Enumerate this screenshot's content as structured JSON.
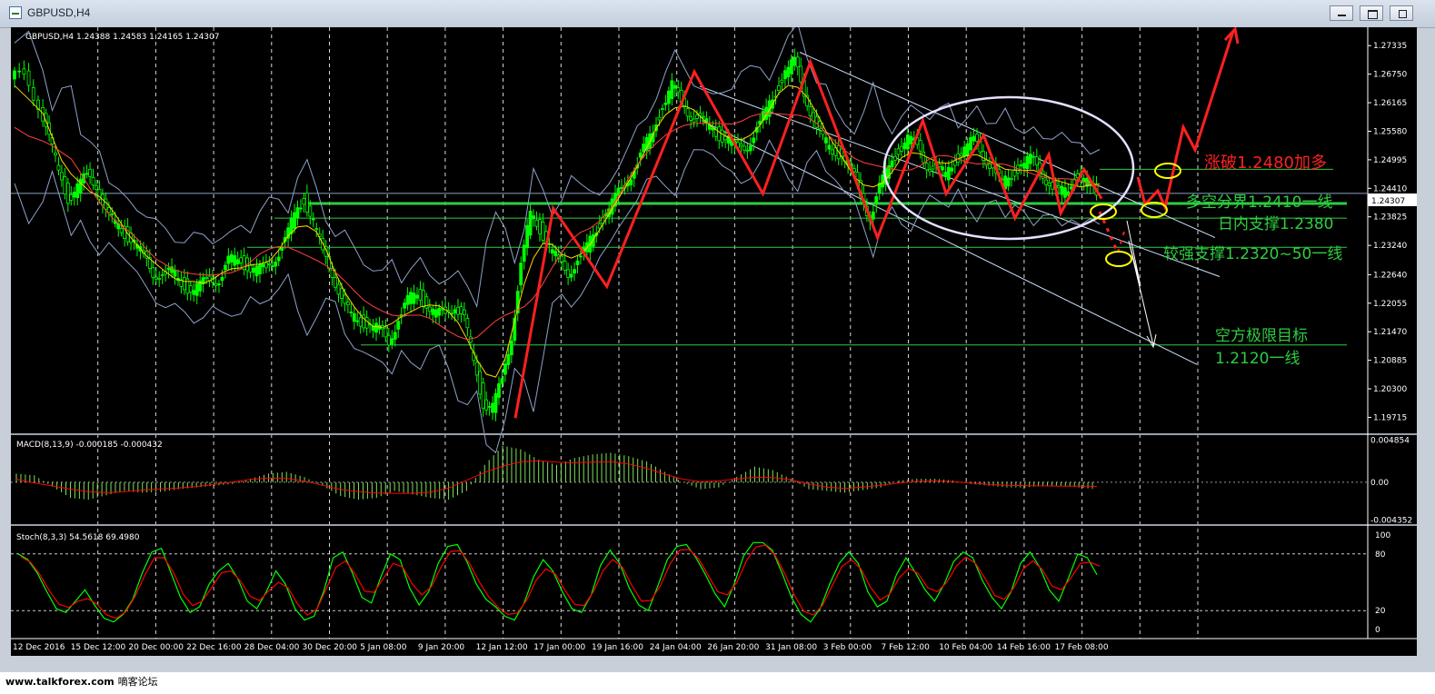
{
  "window": {
    "title": "GBPUSD,H4",
    "buttons": [
      "minimize",
      "restore",
      "close"
    ]
  },
  "footer": {
    "site": "www.talkforex.com",
    "forum": "嘀客论坛"
  },
  "colors": {
    "background": "#000000",
    "bull_candle": "#00ff00",
    "grid": "#ffffff",
    "annotation_red": "#ff2020",
    "annotation_green": "#2ecc40",
    "channel": "#cfe3ff",
    "highlight_ellipse": "#ffff00",
    "macd_signal": "#ff0000",
    "stoch_main": "#00ff00",
    "stoch_signal": "#ff0000"
  },
  "chart_data": [
    {
      "type": "candlestick",
      "symbol_header": "GBPUSD,H4  1.24388 1.24583 1.24165 1.24307",
      "price_axis_ticks": [
        "1.27335",
        "1.26750",
        "1.26165",
        "1.25580",
        "1.24995",
        "1.24410",
        "1.23825",
        "1.23240",
        "1.22640",
        "1.22055",
        "1.21470",
        "1.20885",
        "1.20300",
        "1.19715"
      ],
      "current_price_label": "1.24307",
      "time_axis_labels": [
        "12 Dec 2016",
        "15 Dec 12:00",
        "20 Dec 00:00",
        "22 Dec 16:00",
        "28 Dec 04:00",
        "30 Dec 20:00",
        "5 Jan 08:00",
        "9 Jan 20:00",
        "12 Jan 12:00",
        "17 Jan 00:00",
        "19 Jan 16:00",
        "24 Jan 04:00",
        "26 Jan 20:00",
        "31 Jan 08:00",
        "3 Feb 00:00",
        "7 Feb 12:00",
        "10 Feb 04:00",
        "14 Feb 16:00",
        "17 Feb 08:00"
      ],
      "ylim": [
        1.195,
        1.276
      ],
      "price_path": [
        [
          0,
          1.2665
        ],
        [
          3,
          1.268
        ],
        [
          6,
          1.261
        ],
        [
          8,
          1.254
        ],
        [
          10,
          1.248
        ],
        [
          12,
          1.242
        ],
        [
          14,
          1.244
        ],
        [
          16,
          1.247
        ],
        [
          18,
          1.245
        ],
        [
          20,
          1.239
        ],
        [
          22,
          1.237
        ],
        [
          24,
          1.235
        ],
        [
          26,
          1.233
        ],
        [
          28,
          1.23
        ],
        [
          30,
          1.227
        ],
        [
          32,
          1.226
        ],
        [
          34,
          1.227
        ],
        [
          36,
          1.225
        ],
        [
          38,
          1.223
        ],
        [
          40,
          1.224
        ],
        [
          42,
          1.226
        ],
        [
          44,
          1.225
        ],
        [
          46,
          1.229
        ],
        [
          48,
          1.23
        ],
        [
          50,
          1.228
        ],
        [
          52,
          1.227
        ],
        [
          54,
          1.228
        ],
        [
          56,
          1.23
        ],
        [
          58,
          1.233
        ],
        [
          60,
          1.239
        ],
        [
          62,
          1.242
        ],
        [
          64,
          1.237
        ],
        [
          66,
          1.231
        ],
        [
          68,
          1.227
        ],
        [
          70,
          1.221
        ],
        [
          72,
          1.218
        ],
        [
          74,
          1.217
        ],
        [
          76,
          1.216
        ],
        [
          78,
          1.215
        ],
        [
          80,
          1.213
        ],
        [
          82,
          1.217
        ],
        [
          84,
          1.221
        ],
        [
          86,
          1.223
        ],
        [
          88,
          1.22
        ],
        [
          90,
          1.218
        ],
        [
          92,
          1.219
        ],
        [
          94,
          1.22
        ],
        [
          96,
          1.217
        ],
        [
          98,
          1.209
        ],
        [
          100,
          1.2
        ],
        [
          102,
          1.199
        ],
        [
          104,
          1.205
        ],
        [
          106,
          1.214
        ],
        [
          108,
          1.228
        ],
        [
          110,
          1.239
        ],
        [
          112,
          1.236
        ],
        [
          114,
          1.232
        ],
        [
          116,
          1.229
        ],
        [
          118,
          1.227
        ],
        [
          120,
          1.229
        ],
        [
          122,
          1.232
        ],
        [
          124,
          1.236
        ],
        [
          126,
          1.239
        ],
        [
          128,
          1.242
        ],
        [
          130,
          1.245
        ],
        [
          132,
          1.248
        ],
        [
          134,
          1.252
        ],
        [
          136,
          1.256
        ],
        [
          138,
          1.261
        ],
        [
          140,
          1.265
        ],
        [
          142,
          1.262
        ],
        [
          144,
          1.259
        ],
        [
          146,
          1.258
        ],
        [
          148,
          1.257
        ],
        [
          150,
          1.255
        ],
        [
          152,
          1.254
        ],
        [
          154,
          1.252
        ],
        [
          156,
          1.253
        ],
        [
          158,
          1.256
        ],
        [
          160,
          1.26
        ],
        [
          162,
          1.264
        ],
        [
          164,
          1.268
        ],
        [
          166,
          1.27
        ],
        [
          168,
          1.264
        ],
        [
          170,
          1.258
        ],
        [
          172,
          1.254
        ],
        [
          174,
          1.252
        ],
        [
          176,
          1.251
        ],
        [
          178,
          1.248
        ],
        [
          180,
          1.243
        ],
        [
          182,
          1.238
        ],
        [
          184,
          1.244
        ],
        [
          186,
          1.249
        ],
        [
          188,
          1.252
        ],
        [
          190,
          1.254
        ],
        [
          192,
          1.253
        ],
        [
          194,
          1.249
        ],
        [
          196,
          1.248
        ],
        [
          198,
          1.247
        ],
        [
          200,
          1.25
        ],
        [
          202,
          1.252
        ],
        [
          204,
          1.254
        ],
        [
          206,
          1.251
        ],
        [
          208,
          1.248
        ],
        [
          210,
          1.245
        ],
        [
          212,
          1.247
        ],
        [
          214,
          1.249
        ],
        [
          216,
          1.25
        ],
        [
          218,
          1.248
        ],
        [
          220,
          1.245
        ],
        [
          222,
          1.243
        ],
        [
          224,
          1.244
        ],
        [
          226,
          1.247
        ],
        [
          228,
          1.245
        ],
        [
          230,
          1.243
        ]
      ],
      "zigzag": [
        [
          0.5626,
          1.197
        ],
        [
          0.6038,
          1.24
        ],
        [
          0.662,
          1.224
        ],
        [
          0.757,
          1.268
        ],
        [
          0.8315,
          1.243
        ],
        [
          0.883,
          1.27
        ],
        [
          0.956,
          1.234
        ],
        [
          1.0052,
          1.258
        ],
        [
          1.0305,
          1.243
        ],
        [
          1.0712,
          1.255
        ],
        [
          1.1052,
          1.238
        ],
        [
          1.142,
          1.251
        ],
        [
          1.155,
          1.239
        ],
        [
          1.1802,
          1.248
        ],
        [
          1.1992,
          1.242
        ]
      ],
      "annotations": [
        {
          "text": "涨破1.2480加多",
          "color": "red"
        },
        {
          "text": "多空分界1.2410一线",
          "color": "green"
        },
        {
          "text": "日内支撑1.2380",
          "color": "green"
        },
        {
          "text": "较强支撑1.2320~50一线",
          "color": "green"
        },
        {
          "text": "空方极限目标",
          "color": "green"
        },
        {
          "text": "1.2120一线",
          "color": "green"
        }
      ],
      "horizontal_levels": [
        1.248,
        1.241,
        1.238,
        1.232,
        1.212
      ],
      "grid": true
    },
    {
      "type": "bar",
      "indicator": "MACD(8,13,9) -0.000185 -0.000432",
      "axis_ticks": [
        "0.004854",
        "0.00",
        "-0.004352"
      ],
      "ylim": [
        -0.0044,
        0.0049
      ],
      "values": [
        0.001,
        0.0008,
        -0.0005,
        -0.0018,
        -0.002,
        -0.0015,
        -0.001,
        -0.0012,
        -0.0011,
        -0.0008,
        -0.0006,
        -0.0004,
        -0.0002,
        0.0004,
        0.001,
        0.0012,
        0.0006,
        -0.0004,
        -0.0016,
        -0.002,
        -0.0018,
        -0.001,
        -0.0014,
        -0.0018,
        -0.002,
        -0.001,
        0.002,
        0.0042,
        0.0038,
        0.0026,
        0.002,
        0.0028,
        0.0032,
        0.0034,
        0.003,
        0.0024,
        0.0012,
        0.0,
        -0.0008,
        -0.0006,
        0.0006,
        0.0018,
        0.0014,
        0.0004,
        -0.0008,
        -0.001,
        -0.0012,
        -0.0009,
        -0.0006,
        0.0002,
        0.0004,
        0.0004,
        0.0002,
        -0.0002,
        -0.0004,
        -0.0006,
        -0.0006,
        -0.0004,
        -0.0004,
        -0.0006,
        -0.0008
      ]
    },
    {
      "type": "line",
      "indicator": "Stoch(8,3,3) 54.5618 69.4980",
      "axis_ticks": [
        "100",
        "80",
        "20",
        "0"
      ],
      "levels": [
        80,
        20
      ],
      "ylim": [
        0,
        100
      ],
      "values": [
        80,
        74,
        60,
        40,
        22,
        18,
        30,
        42,
        26,
        12,
        8,
        16,
        32,
        60,
        82,
        86,
        60,
        34,
        18,
        24,
        48,
        62,
        70,
        54,
        30,
        22,
        40,
        62,
        48,
        22,
        10,
        14,
        40,
        76,
        82,
        60,
        34,
        28,
        56,
        80,
        74,
        44,
        26,
        40,
        70,
        88,
        90,
        72,
        48,
        32,
        24,
        14,
        10,
        28,
        56,
        74,
        62,
        40,
        22,
        18,
        36,
        68,
        84,
        70,
        44,
        26,
        20,
        46,
        74,
        88,
        90,
        76,
        58,
        38,
        24,
        48,
        78,
        92,
        92,
        84,
        60,
        34,
        16,
        8,
        22,
        48,
        70,
        82,
        70,
        40,
        24,
        30,
        58,
        76,
        60,
        42,
        30,
        48,
        72,
        82,
        76,
        52,
        34,
        22,
        40,
        70,
        82,
        66,
        42,
        30,
        54,
        80,
        76,
        58
      ]
    }
  ]
}
